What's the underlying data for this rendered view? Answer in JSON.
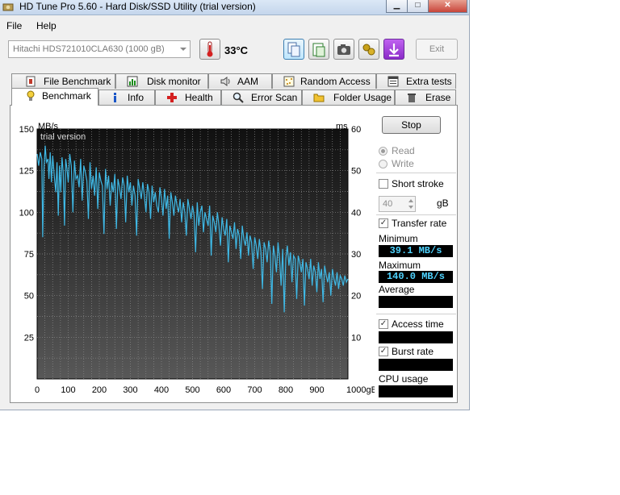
{
  "window": {
    "title": "HD Tune Pro 5.60 - Hard Disk/SSD Utility (trial version)"
  },
  "menu": {
    "items": [
      "File",
      "Help"
    ]
  },
  "toolbar": {
    "drive": "Hitachi HDS721010CLA630 (1000 gB)",
    "temperature": "33°C",
    "exit_label": "Exit"
  },
  "tabs_top": [
    "File Benchmark",
    "Disk monitor",
    "AAM",
    "Random Access",
    "Extra tests"
  ],
  "tabs_bottom": [
    "Benchmark",
    "Info",
    "Health",
    "Error Scan",
    "Folder Usage",
    "Erase"
  ],
  "active_tab": "Benchmark",
  "side": {
    "stop_label": "Stop",
    "read_label": "Read",
    "write_label": "Write",
    "short_stroke_label": "Short stroke",
    "short_stroke_value": "40",
    "short_stroke_unit": "gB",
    "transfer_rate_label": "Transfer rate",
    "minimum_label": "Minimum",
    "minimum_value": "39.1 MB/s",
    "maximum_label": "Maximum",
    "maximum_value": "140.0 MB/s",
    "average_label": "Average",
    "average_value": "",
    "access_time_label": "Access time",
    "access_time_value": "",
    "burst_rate_label": "Burst rate",
    "burst_rate_value": "",
    "cpu_usage_label": "CPU usage",
    "cpu_usage_value": ""
  },
  "chart_data": {
    "type": "line",
    "watermark": "trial version",
    "y_left_unit": "MB/s",
    "y_right_unit": "ms",
    "x_unit_label": "1000gB",
    "x_ticks": [
      "0",
      "100",
      "200",
      "300",
      "400",
      "500",
      "600",
      "700",
      "800",
      "900"
    ],
    "y_left_ticks": [
      "150",
      "125",
      "100",
      "75",
      "50",
      "25"
    ],
    "y_right_ticks": [
      "60",
      "50",
      "40",
      "30",
      "20",
      "10"
    ],
    "xlim": [
      0,
      1000
    ],
    "ylim": [
      0,
      150
    ],
    "y2lim": [
      0,
      60
    ],
    "grid": true,
    "series": [
      {
        "color": "#3fb9e6",
        "x": [
          0,
          5,
          10,
          15,
          18,
          22,
          26,
          30,
          35,
          38,
          42,
          46,
          50,
          55,
          60,
          64,
          68,
          72,
          76,
          80,
          84,
          88,
          92,
          96,
          100,
          105,
          110,
          115,
          120,
          125,
          130,
          135,
          140,
          145,
          150,
          155,
          160,
          165,
          170,
          175,
          180,
          185,
          190,
          195,
          200,
          205,
          210,
          215,
          220,
          225,
          230,
          235,
          240,
          245,
          250,
          255,
          260,
          265,
          270,
          275,
          280,
          285,
          290,
          295,
          300,
          305,
          310,
          315,
          320,
          325,
          330,
          335,
          340,
          345,
          350,
          355,
          360,
          365,
          370,
          375,
          380,
          385,
          390,
          395,
          400,
          405,
          410,
          415,
          420,
          425,
          430,
          435,
          440,
          445,
          450,
          455,
          460,
          465,
          470,
          475,
          480,
          485,
          490,
          495,
          500,
          505,
          510,
          515,
          520,
          525,
          530,
          535,
          540,
          545,
          550,
          555,
          560,
          565,
          570,
          575,
          580,
          585,
          590,
          595,
          600,
          605,
          610,
          615,
          620,
          625,
          630,
          635,
          640,
          645,
          650,
          655,
          660,
          665,
          670,
          675,
          680,
          685,
          690,
          695,
          700,
          705,
          710,
          715,
          720,
          725,
          730,
          735,
          740,
          745,
          750,
          755,
          760,
          765,
          770,
          775,
          780,
          785,
          790,
          795,
          800,
          805,
          810,
          815,
          820,
          825,
          830,
          835,
          840,
          845,
          850,
          855,
          860,
          865,
          870,
          875,
          880,
          885,
          890,
          895,
          900,
          905,
          910,
          915,
          920,
          925,
          930,
          935,
          940,
          945,
          950,
          955,
          960,
          965,
          970,
          975,
          980,
          985,
          990,
          995,
          1000
        ],
        "values": [
          135,
          128,
          136,
          132,
          85,
          126,
          140,
          130,
          132,
          120,
          136,
          118,
          134,
          122,
          112,
          130,
          98,
          128,
          112,
          133,
          124,
          92,
          132,
          126,
          118,
          135,
          128,
          100,
          131,
          120,
          122,
          115,
          132,
          107,
          128,
          124,
          119,
          96,
          130,
          114,
          122,
          110,
          127,
          102,
          124,
          119,
          116,
          87,
          126,
          114,
          122,
          104,
          118,
          112,
          123,
          90,
          120,
          115,
          108,
          121,
          116,
          94,
          122,
          112,
          118,
          104,
          116,
          110,
          86,
          120,
          114,
          108,
          118,
          110,
          100,
          117,
          112,
          96,
          116,
          106,
          112,
          104,
          100,
          115,
          108,
          98,
          114,
          102,
          110,
          84,
          112,
          106,
          98,
          110,
          104,
          100,
          108,
          94,
          106,
          100,
          86,
          108,
          102,
          96,
          104,
          98,
          76,
          106,
          92,
          100,
          104,
          88,
          100,
          96,
          92,
          104,
          74,
          98,
          94,
          88,
          100,
          92,
          80,
          97,
          90,
          86,
          96,
          70,
          92,
          88,
          84,
          94,
          78,
          90,
          86,
          72,
          92,
          84,
          80,
          88,
          74,
          86,
          82,
          66,
          85,
          80,
          72,
          84,
          76,
          54,
          82,
          78,
          70,
          83,
          76,
          45,
          80,
          74,
          64,
          82,
          72,
          56,
          78,
          40,
          72,
          80,
          68,
          76,
          58,
          74,
          72,
          48,
          74,
          70,
          64,
          72,
          44,
          70,
          66,
          60,
          72,
          56,
          68,
          64,
          52,
          70,
          60,
          66,
          46,
          68,
          62,
          58,
          64,
          50,
          66,
          60,
          56,
          64,
          54,
          62,
          60,
          56,
          62,
          58,
          60
        ]
      }
    ]
  }
}
